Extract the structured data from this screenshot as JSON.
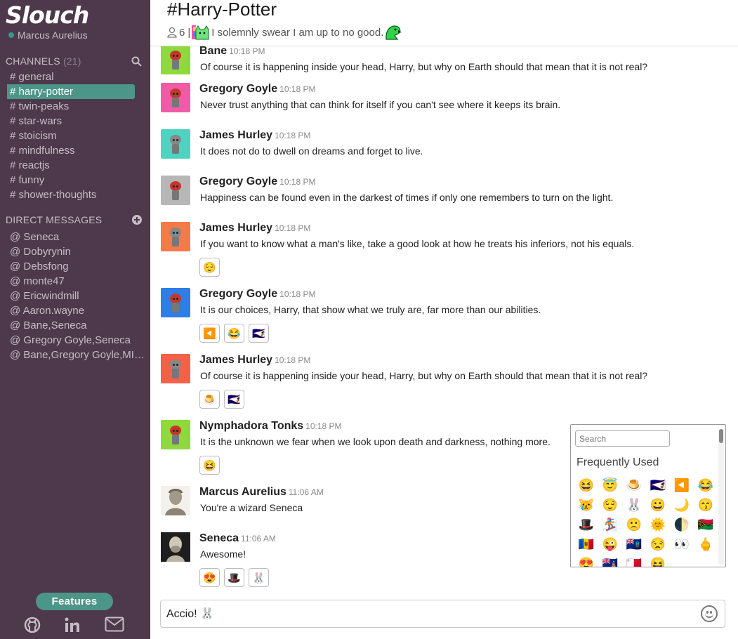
{
  "app": {
    "name": "Slouch",
    "user": "Marcus Aurelius"
  },
  "sidebar": {
    "channels_label": "CHANNELS",
    "channels_count": "(21)",
    "channels": [
      "# general",
      "# harry-potter",
      "# twin-peaks",
      "# star-wars",
      "# stoicism",
      "# mindfulness",
      "# reactjs",
      "# funny",
      "# shower-thoughts"
    ],
    "active_channel_index": 1,
    "dm_label": "DIRECT MESSAGES",
    "dms": [
      "@ Seneca",
      "@ Dobyrynin",
      "@ Debsfong",
      "@ monte47",
      "@ Ericwindmill",
      "@ Aaron.wayne",
      "@ Bane,Seneca",
      "@ Gregory Goyle,Seneca",
      "@ Bane,Gregory Goyle,MIK..."
    ],
    "features_label": "Features"
  },
  "header": {
    "title": "#Harry-Potter",
    "members": "6",
    "separator": "|",
    "topic": "I solemnly swear I am up to no good."
  },
  "messages": [
    {
      "name": "Bane",
      "time": "10:18 PM",
      "text": "Of course it is happening inside your head, Harry, but why on Earth should that mean that it is not real?",
      "avatar_color": "#8fd93a",
      "reactions": []
    },
    {
      "name": "Gregory Goyle",
      "time": "10:18 PM",
      "text": "Never trust anything that can think for itself if you can't see where it keeps its brain.",
      "avatar_color": "#f25aa8",
      "reactions": []
    },
    {
      "name": "James Hurley",
      "time": "10:18 PM",
      "text": "It does not do to dwell on dreams and forget to live.",
      "avatar_color": "#4dd3c0",
      "reactions": []
    },
    {
      "name": "Gregory Goyle",
      "time": "10:18 PM",
      "text": "Happiness can be found even in the darkest of times if only one remembers to turn on the light.",
      "avatar_color": "#b7b7b7",
      "reactions": []
    },
    {
      "name": "James Hurley",
      "time": "10:18 PM",
      "text": "If you want to know what a man's like, take a good look at how he treats his inferiors, not his equals.",
      "avatar_color": "#f47a4a",
      "reactions": [
        "😌"
      ]
    },
    {
      "name": "Gregory Goyle",
      "time": "10:18 PM",
      "text": "It is our choices, Harry, that show what we truly are, far more than our abilities.",
      "avatar_color": "#2f7de8",
      "reactions": [
        "◀️",
        "😂",
        "🇦🇸"
      ]
    },
    {
      "name": "James Hurley",
      "time": "10:18 PM",
      "text": "Of course it is happening inside your head, Harry, but why on Earth should that mean that it is not real?",
      "avatar_color": "#f4604a",
      "reactions": [
        "🍮",
        "🇦🇸"
      ]
    },
    {
      "name": "Nymphadora Tonks",
      "time": "10:18 PM",
      "text": "It is the unknown we fear when we look upon death and darkness, nothing more.",
      "avatar_color": "#8fd93a",
      "reactions": [
        "😆"
      ]
    },
    {
      "name": "Marcus Aurelius",
      "time": "11:06 AM",
      "text": "You're a wizard Seneca",
      "avatar_color": "#e8e2d8",
      "reactions": []
    },
    {
      "name": "Seneca",
      "time": "11:06 AM",
      "text": "Awesome!",
      "avatar_color": "#d8d4cc",
      "reactions": [
        "😍",
        "🎩",
        "🐰"
      ]
    }
  ],
  "picker": {
    "search_placeholder": "Search",
    "section_title": "Frequently Used",
    "emojis": [
      "😆",
      "😇",
      "🍮",
      "🇦🇸",
      "◀️",
      "😂",
      "😿",
      "😌",
      "🐰",
      "😀",
      "🌙",
      "😙",
      "🎩",
      "🏂",
      "🙁",
      "🌞",
      "🌓",
      "🇻🇺",
      "🇲🇩",
      "😜",
      "🇲🇸",
      "😒",
      "👀",
      "🖕",
      "😍",
      "🇰🇾",
      "🇲🇹",
      "😝",
      "",
      ""
    ]
  },
  "composer": {
    "value": "Accio! 🐰"
  }
}
